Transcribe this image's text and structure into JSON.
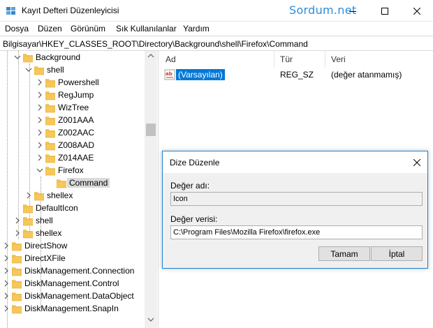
{
  "window": {
    "title": "Kayıt Defteri Düzenleyicisi",
    "watermark": "Sordum.net"
  },
  "menu": [
    "Dosya",
    "Düzen",
    "Görünüm",
    "Sık Kullanılanlar",
    "Yardım"
  ],
  "address": "Bilgisayar\\HKEY_CLASSES_ROOT\\Directory\\Background\\shell\\Firefox\\Command",
  "tree": [
    {
      "label": "Background",
      "expander": "expanded"
    },
    {
      "label": "shell",
      "expander": "expanded"
    },
    {
      "label": "Powershell",
      "expander": "collapsed"
    },
    {
      "label": "RegJump",
      "expander": "collapsed"
    },
    {
      "label": "WizTree",
      "expander": "collapsed"
    },
    {
      "label": "Z001AAA",
      "expander": "collapsed"
    },
    {
      "label": "Z002AAC",
      "expander": "collapsed"
    },
    {
      "label": "Z008AAD",
      "expander": "collapsed"
    },
    {
      "label": "Z014AAE",
      "expander": "collapsed"
    },
    {
      "label": "Firefox",
      "expander": "expanded"
    },
    {
      "label": "Command",
      "expander": "none",
      "selected": true
    },
    {
      "label": "shellex",
      "expander": "collapsed"
    },
    {
      "label": "DefaultIcon",
      "expander": "none"
    },
    {
      "label": "shell",
      "expander": "collapsed"
    },
    {
      "label": "shellex",
      "expander": "collapsed"
    },
    {
      "label": "DirectShow",
      "expander": "collapsed"
    },
    {
      "label": "DirectXFile",
      "expander": "collapsed"
    },
    {
      "label": "DiskManagement.Connection",
      "expander": "collapsed"
    },
    {
      "label": "DiskManagement.Control",
      "expander": "collapsed"
    },
    {
      "label": "DiskManagement.DataObject",
      "expander": "collapsed"
    },
    {
      "label": "DiskManagement.SnapIn",
      "expander": "collapsed"
    }
  ],
  "list": {
    "columns": [
      "Ad",
      "Tür",
      "Veri"
    ],
    "rows": [
      {
        "name": "(Varsayılan)",
        "type": "REG_SZ",
        "data": "(değer atanmamış)"
      }
    ]
  },
  "dialog": {
    "title": "Dize Düzenle",
    "name_label": "Değer adı:",
    "name_value": "Icon",
    "data_label": "Değer verisi:",
    "data_value": "C:\\Program Files\\Mozilla Firefox\\firefox.exe",
    "ok_label": "Tamam",
    "cancel_label": "İptal"
  },
  "colors": {
    "accent": "#0078d7",
    "folder": "#f6c85a",
    "watermark": "#2f8ed8"
  }
}
